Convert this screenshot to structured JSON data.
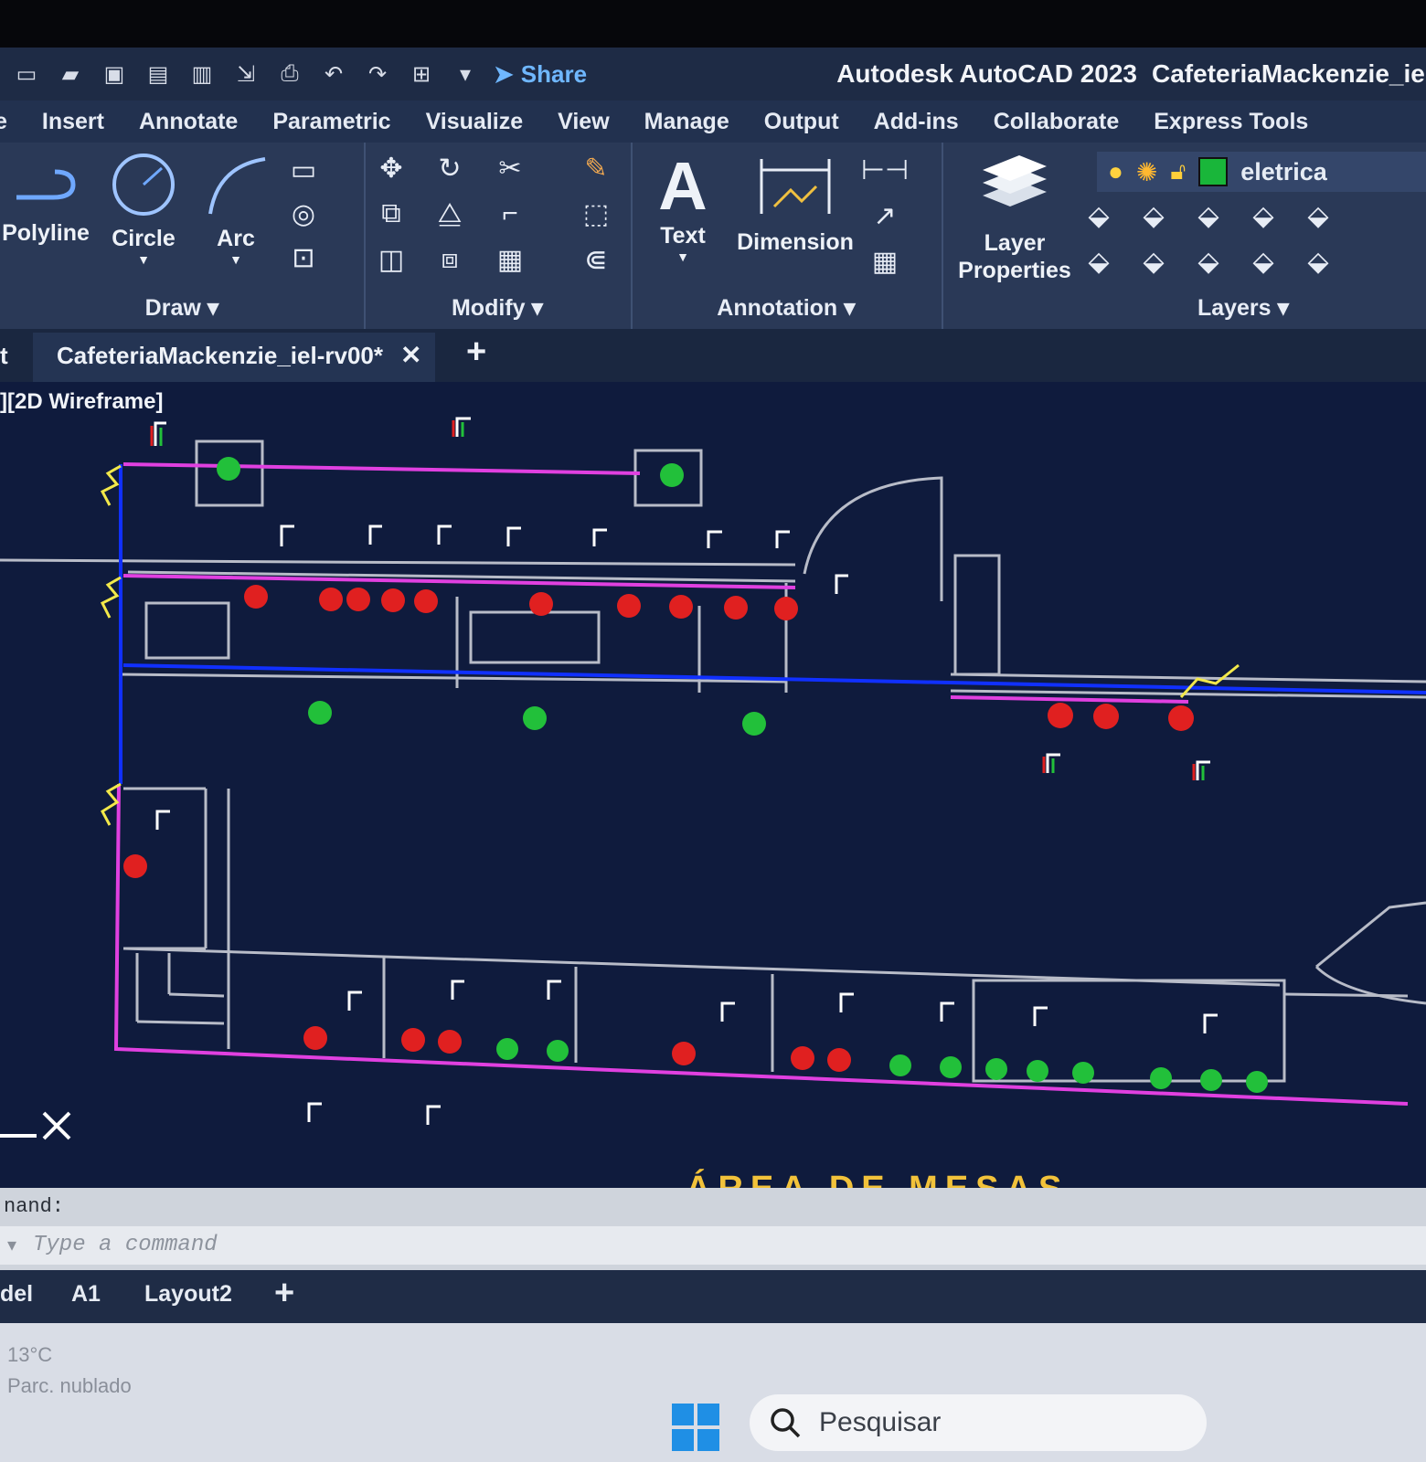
{
  "titlebar": {
    "share_label": "Share",
    "app_title": "Autodesk AutoCAD 2023",
    "doc_title": "CafeteriaMackenzie_iel"
  },
  "ribbon_tabs": [
    "Insert",
    "Annotate",
    "Parametric",
    "Visualize",
    "View",
    "Manage",
    "Output",
    "Add-ins",
    "Collaborate",
    "Express Tools"
  ],
  "ribbon": {
    "draw": {
      "title": "Draw",
      "polyline": "Polyline",
      "circle": "Circle",
      "arc": "Arc"
    },
    "modify": {
      "title": "Modify"
    },
    "annotation": {
      "title": "Annotation",
      "text": "Text",
      "dimension": "Dimension"
    },
    "layers": {
      "title": "Layers",
      "layer_properties_line1": "Layer",
      "layer_properties_line2": "Properties",
      "current_layer": "eletrica"
    }
  },
  "doc_tabs": {
    "partial": "t",
    "active": "CafeteriaMackenzie_iel-rv00*"
  },
  "viewport": {
    "label": "][2D Wireframe]",
    "area_label": "ÁREA DE MESAS"
  },
  "command": {
    "history": "nand:",
    "placeholder": "Type a command"
  },
  "layout_tabs": [
    "del",
    "A1",
    "Layout2"
  ],
  "taskbar": {
    "temperature": "13°C",
    "weather": "Parc. nublado",
    "search_label": "Pesquisar"
  },
  "colors": {
    "circuit_blue": "#1030ff",
    "circuit_magenta": "#e040e0",
    "outlet_red": "#e02020",
    "lamp_green": "#22c03a",
    "walls": "#b8bcc8",
    "accent_share": "#6fb7ff"
  }
}
